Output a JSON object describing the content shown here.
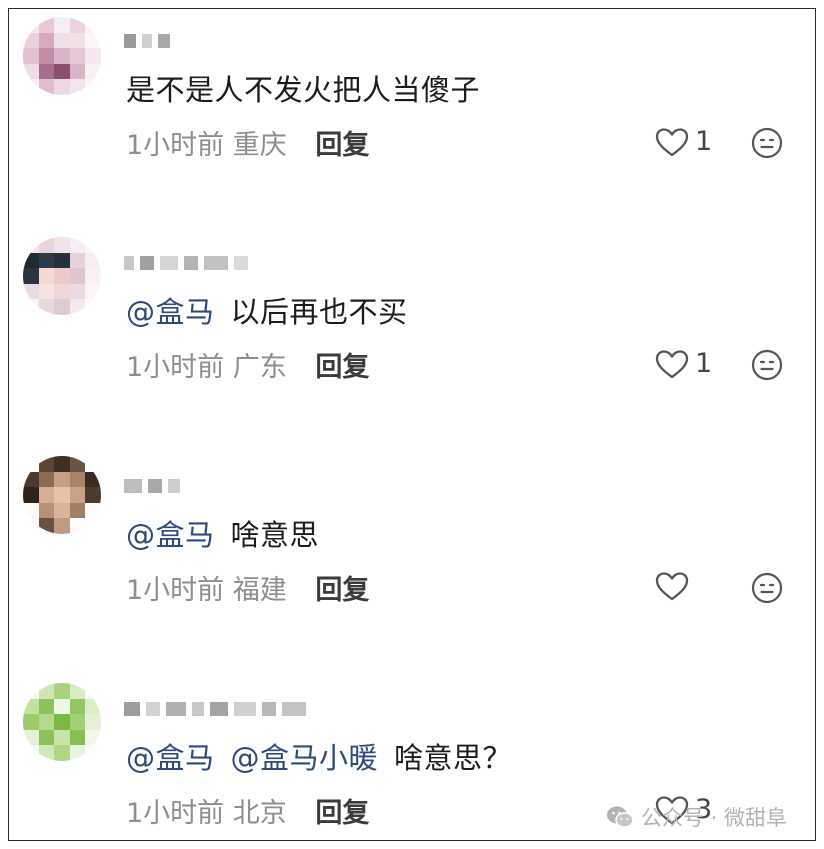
{
  "comments": [
    {
      "text": "是不是人不发火把人当傻子",
      "mentions": [],
      "time": "1小时前",
      "location": "重庆",
      "reply": "回复",
      "likes": "1"
    },
    {
      "text": "以后再也不买",
      "mentions": [
        "@盒马"
      ],
      "time": "1小时前",
      "location": "广东",
      "reply": "回复",
      "likes": "1"
    },
    {
      "text": "啥意思",
      "mentions": [
        "@盒马"
      ],
      "time": "1小时前",
      "location": "福建",
      "reply": "回复",
      "likes": ""
    },
    {
      "text": "啥意思？",
      "mentions": [
        "@盒马",
        "@盒马小暖"
      ],
      "time": "1小时前",
      "location": "北京",
      "reply": "回复",
      "likes": "3"
    }
  ],
  "watermark": "公众号 · 微甜阜",
  "colors": {
    "mention": "#2d4a7a",
    "meta": "#8e8e8e",
    "border": "#2a2a2a"
  },
  "icons": {
    "like": "heart-outline-icon",
    "emoji": "neutral-face-icon",
    "watermark": "wechat-icon"
  }
}
